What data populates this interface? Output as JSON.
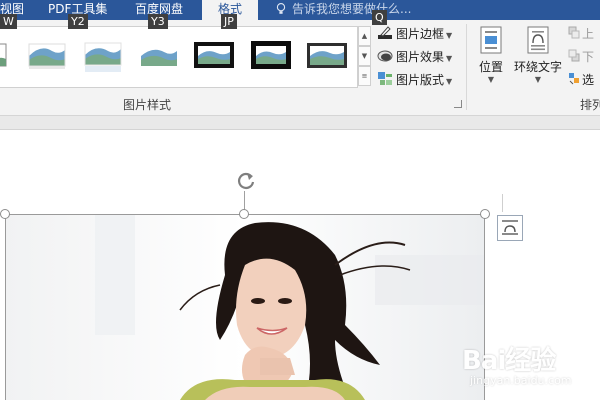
{
  "tabs": {
    "view": "视图",
    "pdf": "PDF工具集",
    "baidu": "百度网盘",
    "format": "格式"
  },
  "keytips": {
    "view": "W",
    "pdf": "Y2",
    "baidu": "Y3",
    "format": "JP",
    "tellme": "Q"
  },
  "tellme": {
    "placeholder": "告诉我您想要做什么..."
  },
  "picture_styles": {
    "group_label": "图片样式",
    "border": "图片边框",
    "effects": "图片效果",
    "layout": "图片版式"
  },
  "arrange": {
    "position": "位置",
    "wrap_text": "环绕文字",
    "group_label_partial": "排列",
    "bring_forward_partial": "上",
    "send_backward_partial": "下",
    "selection_partial": "选"
  },
  "watermark": {
    "main": "Bai经验",
    "sub": "jingyan.baidu.com"
  },
  "colors": {
    "accent": "#2b579a",
    "ribbon_bg": "#f3f3f3",
    "keytip_bg": "#3f3f3f"
  }
}
